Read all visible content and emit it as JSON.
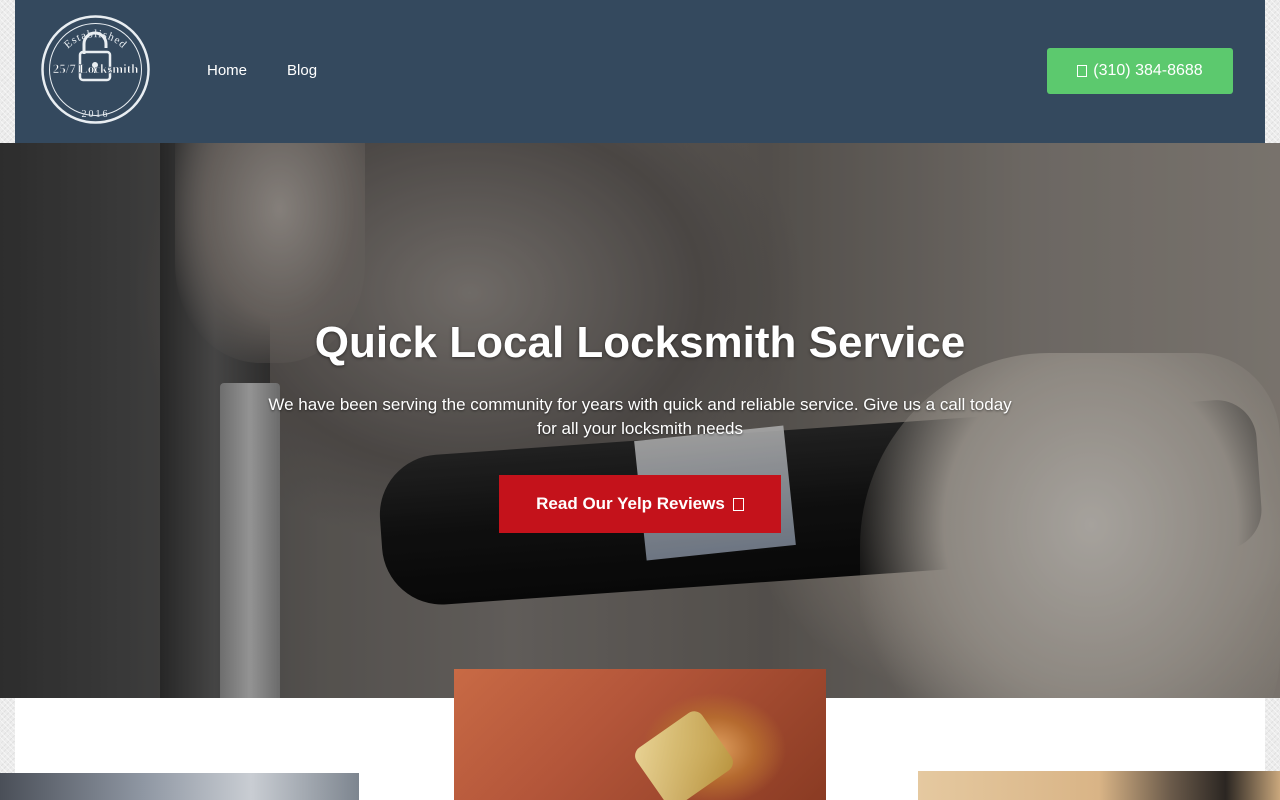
{
  "header": {
    "logo": {
      "top_text": "Established",
      "main_text": "25/7 Locksmith",
      "year": "2016"
    },
    "nav": [
      {
        "label": "Home"
      },
      {
        "label": "Blog"
      }
    ],
    "phone_button": {
      "icon": "phone-icon",
      "label": "(310) 384-8688",
      "color": "#5cc96e"
    },
    "background_color": "#34495e"
  },
  "hero": {
    "title": "Quick Local Locksmith Service",
    "subtitle": "We have been serving the community for years with quick and reliable service. Give us a call today for all your locksmith needs",
    "cta": {
      "label": "Read Our Yelp Reviews",
      "icon": "external-link-icon",
      "color": "#c4121b"
    }
  }
}
